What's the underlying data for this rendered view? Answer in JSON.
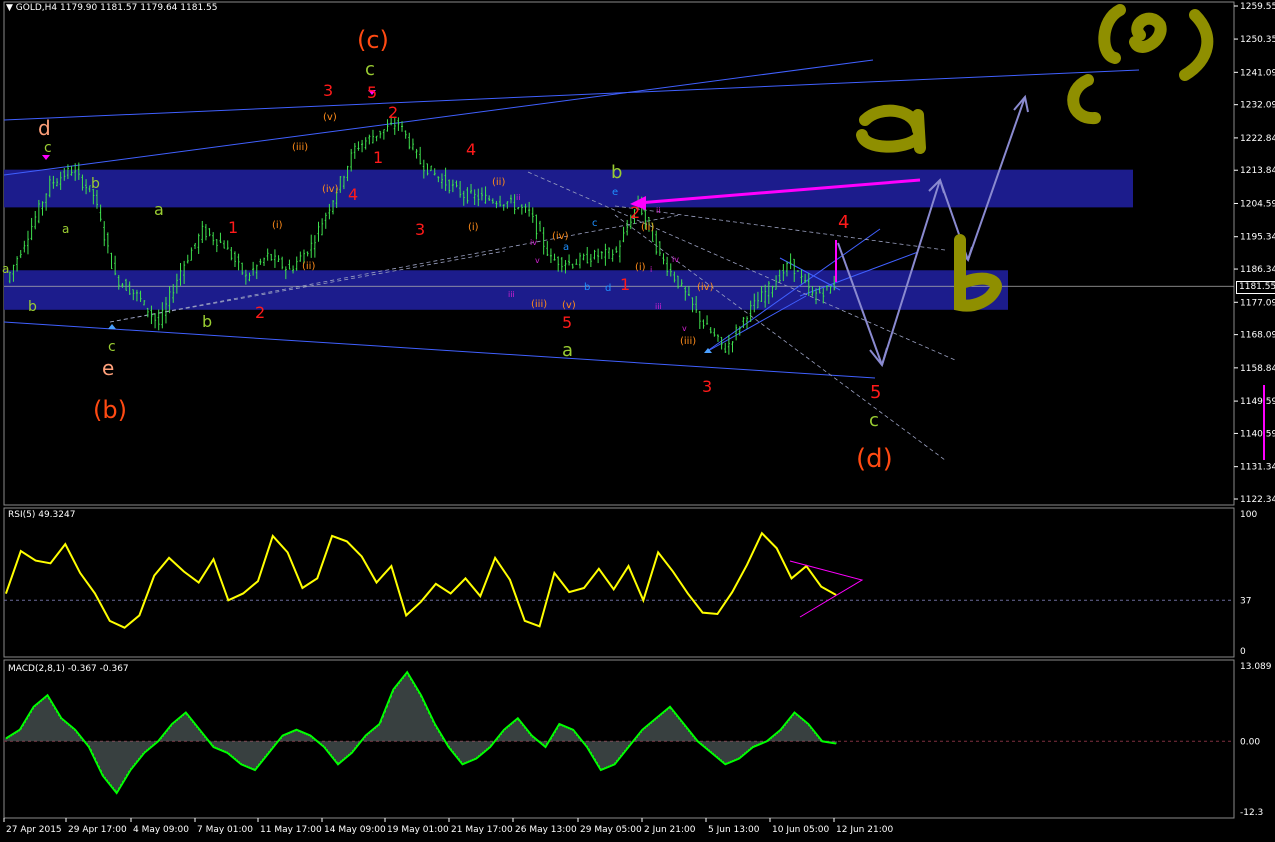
{
  "main_header": {
    "symbol": "GOLD,H4",
    "ohlc": "1179.90 1181.57 1179.64 1181.55"
  },
  "rsi_header": "RSI(5) 49.3247",
  "macd_header": "MACD(2,8,1) -0.367 -0.367",
  "current_price": "1181.55",
  "price_axis": [
    "1259.55",
    "1250.35",
    "1241.09",
    "1232.09",
    "1222.84",
    "1213.84",
    "1204.59",
    "1195.34",
    "1186.34",
    "1177.09",
    "1168.09",
    "1158.84",
    "1149.59",
    "1140.59",
    "1131.34",
    "1122.34"
  ],
  "rsi_axis": [
    "100",
    "37",
    "0"
  ],
  "macd_axis": [
    "13.089",
    "0.00",
    "-12.3"
  ],
  "time_axis": [
    "27 Apr 2015",
    "29 Apr 17:00",
    "4 May 09:00",
    "7 May 01:00",
    "11 May 17:00",
    "14 May 09:00",
    "19 May 01:00",
    "21 May 17:00",
    "26 May 13:00",
    "29 May 05:00",
    "2 Jun 21:00",
    "5 Jun 13:00",
    "10 Jun 05:00",
    "12 Jun 21:00"
  ],
  "wave_labels": [
    {
      "t": "(c)",
      "c": "#ff4a12"
    },
    {
      "t": "c",
      "c": "#9acd32"
    },
    {
      "t": "3",
      "c": "#ff1a1a"
    },
    {
      "t": "5",
      "c": "#ff1a1a"
    },
    {
      "t": "2",
      "c": "#ff1a1a"
    },
    {
      "t": "(v)",
      "c": "#ff8c1a"
    },
    {
      "t": "(iii)",
      "c": "#ff8c1a"
    },
    {
      "t": "(iv)",
      "c": "#ff8c1a"
    },
    {
      "t": "1",
      "c": "#ff1a1a"
    },
    {
      "t": "4",
      "c": "#ff1a1a"
    },
    {
      "t": "d",
      "c": "#ffa07a"
    },
    {
      "t": "c",
      "c": "#9acd32"
    },
    {
      "t": "b",
      "c": "#9acd32"
    },
    {
      "t": "a",
      "c": "#9acd32"
    },
    {
      "t": "a",
      "c": "#9acd32"
    },
    {
      "t": "a",
      "c": "#9acd32"
    },
    {
      "t": "b",
      "c": "#9acd32"
    },
    {
      "t": "b",
      "c": "#9acd32"
    },
    {
      "t": "c",
      "c": "#9acd32"
    },
    {
      "t": "e",
      "c": "#ffa07a"
    },
    {
      "t": "(b)",
      "c": "#ff4a12"
    },
    {
      "t": "1",
      "c": "#ff1a1a"
    },
    {
      "t": "2",
      "c": "#ff1a1a"
    },
    {
      "t": "(i)",
      "c": "#ff8c1a"
    },
    {
      "t": "(ii)",
      "c": "#ff8c1a"
    },
    {
      "t": "4",
      "c": "#ff1a1a"
    },
    {
      "t": "3",
      "c": "#ff1a1a"
    },
    {
      "t": "(i)",
      "c": "#ff8c1a"
    },
    {
      "t": "(ii)",
      "c": "#ff8c1a"
    },
    {
      "t": "ii",
      "c": "#d020d0"
    },
    {
      "t": "b",
      "c": "#9acd32"
    },
    {
      "t": "e",
      "c": "#1e90ff"
    },
    {
      "t": "c",
      "c": "#1e90ff"
    },
    {
      "t": "2",
      "c": "#ff1a1a"
    },
    {
      "t": "(ii)",
      "c": "#ff8c1a"
    },
    {
      "t": "ii",
      "c": "#d020d0"
    },
    {
      "t": "iv",
      "c": "#d020d0"
    },
    {
      "t": "(iv)",
      "c": "#ff8c1a"
    },
    {
      "t": "a",
      "c": "#1e90ff"
    },
    {
      "t": "v",
      "c": "#d020d0"
    },
    {
      "t": "iii",
      "c": "#d020d0"
    },
    {
      "t": "(iii)",
      "c": "#ff8c1a"
    },
    {
      "t": "(v)",
      "c": "#ff8c1a"
    },
    {
      "t": "5",
      "c": "#ff1a1a"
    },
    {
      "t": "b",
      "c": "#1e90ff"
    },
    {
      "t": "d",
      "c": "#1e90ff"
    },
    {
      "t": "1",
      "c": "#ff1a1a"
    },
    {
      "t": "(i)",
      "c": "#ff8c1a"
    },
    {
      "t": "i",
      "c": "#d020d0"
    },
    {
      "t": "iii",
      "c": "#d020d0"
    },
    {
      "t": "iv",
      "c": "#d020d0"
    },
    {
      "t": "(iv)",
      "c": "#ff8c1a"
    },
    {
      "t": "v",
      "c": "#d020d0"
    },
    {
      "t": "(iii)",
      "c": "#ff8c1a"
    },
    {
      "t": "a",
      "c": "#9acd32"
    },
    {
      "t": "3",
      "c": "#ff1a1a"
    },
    {
      "t": "4",
      "c": "#ff1a1a"
    },
    {
      "t": "5",
      "c": "#ff1a1a"
    },
    {
      "t": "c",
      "c": "#9acd32"
    },
    {
      "t": "(d)",
      "c": "#ff4a12"
    }
  ],
  "handwritten_labels": [
    "a",
    "b",
    "c",
    "(e)"
  ],
  "colors": {
    "background": "#000000",
    "candles": "#3fe04f",
    "rsi_line": "#ffff00",
    "macd_line": "#00ff00",
    "macd_hist": "#708080",
    "zones": "#1c1c8c",
    "trendlines": "#4060ff",
    "projection": "#8a8ad0",
    "magenta": "#ff00ff",
    "handwriting": "#8f8f00",
    "grid_level": "#6a6a9a"
  },
  "chart_data": [
    {
      "type": "candlestick",
      "title": "GOLD,H4",
      "x_ticks": [
        "27 Apr 2015",
        "29 Apr 17:00",
        "4 May 09:00",
        "7 May 01:00",
        "11 May 17:00",
        "14 May 09:00",
        "19 May 01:00",
        "21 May 17:00",
        "26 May 13:00",
        "29 May 05:00",
        "2 Jun 21:00",
        "5 Jun 13:00",
        "10 Jun 05:00",
        "12 Jun 21:00"
      ],
      "y_ticks": [
        1259.55,
        1250.35,
        1241.09,
        1232.09,
        1222.84,
        1213.84,
        1204.59,
        1195.34,
        1186.34,
        1177.09,
        1168.09,
        1158.84,
        1149.59,
        1140.59,
        1131.34,
        1122.34
      ],
      "last_price": 1181.55,
      "close_path": [
        [
          "27 Apr 2015",
          1183
        ],
        [
          "28 Apr",
          1196
        ],
        [
          "28 Apr 12:00",
          1210
        ],
        [
          "29 Apr 05:00",
          1214
        ],
        [
          "29 Apr 17:00",
          1207
        ],
        [
          "30 Apr",
          1184
        ],
        [
          "1 May",
          1179
        ],
        [
          "1 May 12:00",
          1171
        ],
        [
          "4 May 09:00",
          1186
        ],
        [
          "5 May",
          1197
        ],
        [
          "6 May",
          1193
        ],
        [
          "7 May 01:00",
          1184
        ],
        [
          "8 May",
          1190
        ],
        [
          "8 May 12:00",
          1186
        ],
        [
          "11 May 17:00",
          1193
        ],
        [
          "12 May",
          1206
        ],
        [
          "13 May",
          1220
        ],
        [
          "14 May 09:00",
          1224
        ],
        [
          "14 May 12:00",
          1227
        ],
        [
          "15 May",
          1216
        ],
        [
          "19 May 01:00",
          1211
        ],
        [
          "20 May",
          1207
        ],
        [
          "21 May 17:00",
          1206
        ],
        [
          "22 May",
          1205
        ],
        [
          "25 May",
          1202
        ],
        [
          "26 May 13:00",
          1189
        ],
        [
          "27 May",
          1188
        ],
        [
          "28 May",
          1190
        ],
        [
          "29 May 05:00",
          1191
        ],
        [
          "1 Jun",
          1205
        ],
        [
          "2 Jun 21:00",
          1190
        ],
        [
          "3 Jun",
          1181
        ],
        [
          "4 Jun",
          1171
        ],
        [
          "5 Jun 13:00",
          1164
        ],
        [
          "8 Jun",
          1174
        ],
        [
          "9 Jun",
          1181
        ],
        [
          "10 Jun 05:00",
          1188
        ],
        [
          "11 Jun",
          1179
        ],
        [
          "12 Jun 21:00",
          1181.55
        ]
      ]
    },
    {
      "type": "line",
      "title": "RSI(5)",
      "value": 49.3247,
      "ylim": [
        0,
        100
      ],
      "level": 37,
      "series": [
        {
          "values": [
            42,
            73,
            66,
            64,
            78,
            57,
            42,
            22,
            17,
            26,
            55,
            68,
            58,
            50,
            67,
            37,
            42,
            51,
            84,
            72,
            46,
            53,
            84,
            80,
            69,
            50,
            62,
            26,
            36,
            49,
            42,
            53,
            40,
            68,
            52,
            22,
            18,
            57,
            43,
            46,
            60,
            45,
            62,
            37,
            72,
            58,
            42,
            28,
            27,
            43,
            63,
            86,
            75,
            53,
            62,
            47,
            41
          ]
        }
      ]
    },
    {
      "type": "line",
      "title": "MACD(2,8,1)",
      "value": -0.367,
      "ylim": [
        -12.3,
        13.089
      ],
      "series": [
        {
          "values": [
            0.5,
            2,
            6,
            8,
            4,
            2,
            -1,
            -6,
            -9,
            -5,
            -2,
            0,
            3,
            5,
            2,
            -1,
            -2,
            -4,
            -5,
            -2,
            1,
            2,
            1,
            -1,
            -4,
            -2,
            1,
            3,
            9,
            12,
            8,
            3,
            -1,
            -4,
            -3,
            -1,
            2,
            4,
            1,
            -1,
            3,
            2,
            -1,
            -5,
            -4,
            -1,
            2,
            4,
            6,
            3,
            0,
            -2,
            -4,
            -3,
            -1,
            0,
            2,
            5,
            3,
            0,
            -0.4
          ]
        }
      ]
    }
  ]
}
